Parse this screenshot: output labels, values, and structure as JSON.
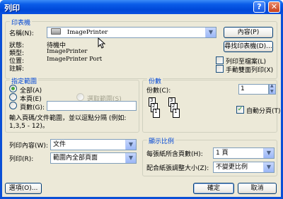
{
  "window": {
    "title": "列印"
  },
  "printer_group": {
    "legend": "印表機",
    "name_label": "名稱(N):",
    "name_value": "ImagePrinter",
    "properties_button": "內容(P)",
    "find_printer_button": "尋找印表機(D)...",
    "status_label": "狀態:",
    "status_value": "待機中",
    "type_label": "類型:",
    "type_value": "ImagePrinter",
    "where_label": "位置:",
    "where_value": "ImagePrinter Port",
    "comment_label": "註解:",
    "print_to_file_label": "列印至檔案(L)",
    "manual_duplex_label": "手動雙面列印(X)",
    "print_to_file_checked": false,
    "manual_duplex_checked": false
  },
  "range_group": {
    "legend": "指定範圍",
    "all_label": "全部(A)",
    "current_label": "本頁(E)",
    "selection_label": "選取範圍(S)",
    "pages_label": "頁數(G):",
    "pages_value": "",
    "hint_line1": "輸入頁碼/文件範圍，並以逗點分隔 (例如:",
    "hint_line2": "1,3,5 - 12)。",
    "selected": "all"
  },
  "copies_group": {
    "legend": "份數",
    "copies_label": "份數(C):",
    "copies_value": "1",
    "collate_label": "自動分頁(T)",
    "collate_checked": true
  },
  "print_what": {
    "label": "列印內容(W):",
    "value": "文件"
  },
  "print_scope": {
    "label": "列印(R):",
    "value": "範圍內全部頁面"
  },
  "zoom_group": {
    "legend": "顯示比例",
    "pages_per_sheet_label": "每張紙所含頁數(H):",
    "pages_per_sheet_value": "1 頁",
    "scale_label": "配合紙張調整大小(Z):",
    "scale_value": "不變更比例"
  },
  "footer": {
    "options_button": "選項(O)...",
    "ok_button": "確定",
    "cancel_button": "取消"
  },
  "colors": {
    "title_bar": "#0a50e0",
    "dialog_bg": "#ece9d8",
    "legend_text": "#0046d5"
  }
}
